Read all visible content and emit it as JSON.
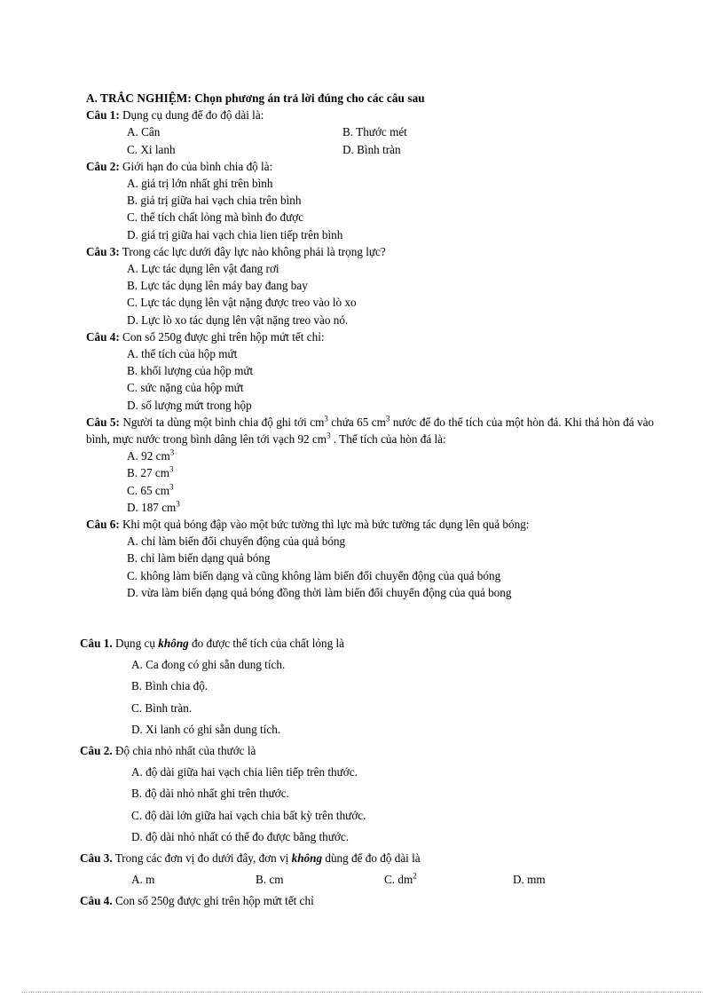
{
  "document": {
    "section_heading": "A. TRẮC NGHIỆM: Chọn phương án trả lời đúng cho các câu sau",
    "part_one": {
      "questions": [
        {
          "label": "Câu 1:",
          "stem": "Dụng cụ dung để đo độ dài là:",
          "layout": "two-column",
          "options": [
            "A. Cân",
            "B. Thước mét",
            "C. Xi lanh",
            "D. Bình tràn"
          ]
        },
        {
          "label": "Câu 2:",
          "stem": "Giới hạn đo của bình chia độ là:",
          "layout": "stacked",
          "options": [
            "A. giá trị lớn nhất ghi trên bình",
            "B. giá trị giữa hai vạch chia trên bình",
            "C. thể tích chất lỏng mà bình đo được",
            "D. giá trị giữa hai vạch chia lien tiếp trên bình"
          ]
        },
        {
          "label": "Câu 3:",
          "stem": "Trong các lực dưới đây lực nào không phải là trọng lực?",
          "layout": "stacked",
          "options": [
            "A. Lực tác dụng lên vật đang rơi",
            "B. Lực tác dụng lên máy bay đang bay",
            "C. Lực tác dụng lên vật nặng được treo vào lò xo",
            "D. Lực lò xo tác dụng lên vật nặng treo vào nó."
          ]
        },
        {
          "label": "Câu 4:",
          "stem": "Con số 250g được ghi trên hộp mứt tết chỉ:",
          "layout": "stacked",
          "options": [
            "A. thể tích của hộp mứt",
            "B. khối lượng của hộp mứt",
            "C. sức nặng của hộp mứt",
            "D. số lượng mứt trong hộp"
          ]
        },
        {
          "label": "Câu 5:",
          "stem_parts": {
            "p1": "Người ta dùng một bình chia độ ghi tới cm",
            "sup1": "3",
            "p2": " chứa 65 cm",
            "sup2": "3",
            "p3": " nước để đo thể tích của một hòn đá. Khi thả hòn đá vào bình, mực nước trong bình dâng lên tới vạch 92 cm",
            "sup3": "3",
            "p4": " . Thể tích của hòn đá là:"
          },
          "layout": "paragraph",
          "options_sup": [
            {
              "text": "A. 92 cm",
              "sup": "3"
            },
            {
              "text": "B. 27 cm",
              "sup": "3"
            },
            {
              "text": "C. 65 cm",
              "sup": "3"
            },
            {
              "text": "D. 187 cm",
              "sup": "3"
            }
          ]
        },
        {
          "label": "Câu 6:",
          "stem": "Khi một quả bóng đập vào một bức tường thì lực mà bức tường tác dụng lên quả bóng:",
          "layout": "stacked",
          "options": [
            "A. chỉ làm biến đổi chuyển động của quả bóng",
            "B. chỉ làm biến dạng quả bóng",
            "C. không làm biến dạng và cũng không làm biến đổi chuyển động của quả bóng",
            "D. vừa làm biến dạng quả bóng đồng thời làm biến đổi chuyển động của quả bong"
          ]
        }
      ]
    },
    "part_two": {
      "questions": [
        {
          "label": "Câu 1.",
          "stem_before": "Dụng cụ ",
          "stem_emph": "không",
          "stem_after": " đo được thể tích của chất lỏng là",
          "layout": "stacked",
          "options": [
            "A. Ca đong có ghi sẵn dung tích.",
            "B. Bình chia độ.",
            "C. Bình tràn.",
            "D. Xi lanh có ghi sẵn dung tích."
          ]
        },
        {
          "label": "Câu 2.",
          "stem": "Độ chia nhỏ nhất của thước là",
          "layout": "stacked",
          "options": [
            "A. độ dài giữa hai vạch chia liên tiếp trên thước.",
            "B. độ dài nhỏ nhất ghi trên thước.",
            "C. độ dài lớn giữa hai vạch chia bất kỳ trên thước.",
            "D. độ dài nhỏ nhất có thể đo được bằng thước."
          ]
        },
        {
          "label": "Câu 3.",
          "stem_before": "Trong các đơn vị đo dưới đây, đơn vị ",
          "stem_emph": "không",
          "stem_after": " dùng để đo độ dài là",
          "layout": "four-column",
          "options": [
            {
              "text": "A. m",
              "sup": ""
            },
            {
              "text": "B. cm",
              "sup": ""
            },
            {
              "text": "C. dm",
              "sup": "2"
            },
            {
              "text": "D. mm",
              "sup": ""
            }
          ]
        },
        {
          "label": "Câu 4.",
          "stem": "Con số 250g được ghi trên hộp mứt tết chỉ",
          "layout": "stem-only",
          "options": []
        }
      ]
    }
  }
}
